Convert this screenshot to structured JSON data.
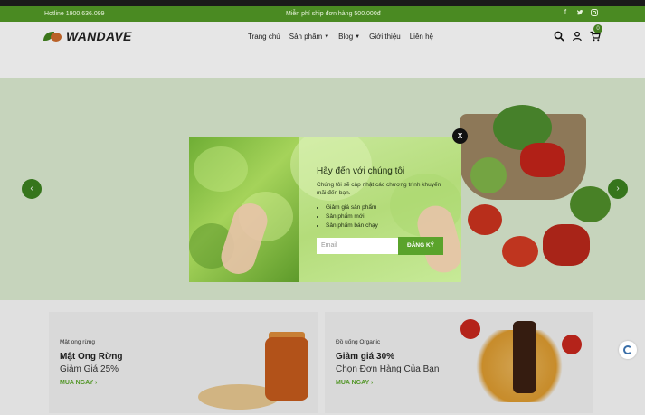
{
  "topbar": {
    "hotline": "Hotline 1900.636.099",
    "promo": "Miễn phí ship đơn hàng 500.000đ",
    "social": [
      "facebook-icon",
      "twitter-icon",
      "instagram-icon"
    ]
  },
  "header": {
    "logo": "WANDAVE",
    "nav": [
      {
        "label": "Trang chủ",
        "has_caret": false
      },
      {
        "label": "Sản phẩm",
        "has_caret": true
      },
      {
        "label": "Blog",
        "has_caret": true
      },
      {
        "label": "Giới thiệu",
        "has_caret": false
      },
      {
        "label": "Liên hệ",
        "has_caret": false
      }
    ],
    "cart_count": "0"
  },
  "hero": {
    "prev_icon": "chevron-left-icon",
    "next_icon": "chevron-right-icon"
  },
  "modal": {
    "title": "Hãy đến với chúng tôi",
    "description": "Chúng tôi sẽ cập nhật các chương trình khuyến mãi đến bạn.",
    "benefits": [
      "Giảm giá sản phẩm",
      "Sản phẩm mới",
      "Sản phẩm bán chạy"
    ],
    "email_placeholder": "Email",
    "subscribe_label": "ĐĂNG KÝ",
    "close_label": "X"
  },
  "promos": [
    {
      "tag": "Mật ong rừng",
      "headline": "Mật Ong Rừng",
      "subline": "Giảm Giá 25%",
      "cta": "MUA NGAY ›"
    },
    {
      "tag": "Đồ uống Organic",
      "headline": "Giảm giá 30%",
      "subline": "Chọn Đơn Hàng Của Bạn",
      "cta": "MUA NGAY ›"
    }
  ],
  "colors": {
    "brand_green": "#4a8a22",
    "button_green": "#5aa32b",
    "hero_bg": "#d7e6cd"
  }
}
